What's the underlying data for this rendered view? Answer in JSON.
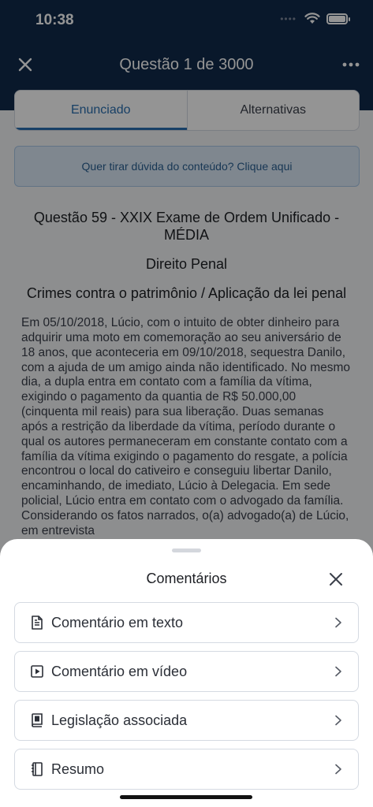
{
  "status_bar": {
    "time": "10:38",
    "signal_dots": "••••"
  },
  "header": {
    "title": "Questão 1 de 3000",
    "close_icon": "close-icon",
    "more_icon": "more-icon"
  },
  "tabs": [
    {
      "label": "Enunciado",
      "active": true
    },
    {
      "label": "Alternativas",
      "active": false
    }
  ],
  "doubt_banner": {
    "text": "Quer tirar dúvida do conteúdo? Clique aqui"
  },
  "question": {
    "title": "Questão 59 - XXIX Exame de Ordem Unificado - MÉDIA",
    "subject": "Direito Penal",
    "topic": "Crimes contra o patrimônio / Aplicação da lei penal",
    "body": "Em 05/10/2018, Lúcio, com o intuito de obter dinheiro para adquirir uma moto em comemoração ao seu aniversário de 18 anos, que aconteceria em 09/10/2018, sequestra Danilo, com a ajuda de um amigo ainda não identificado. No mesmo dia, a dupla entra em contato com a família da vítima, exigindo o pagamento da quantia de R$ 50.000,00 (cinquenta mil reais) para sua liberação. Duas semanas após a restrição da liberdade da vítima, período durante o qual os autores permaneceram em constante contato com a família da vítima exigindo o pagamento do resgate, a polícia encontrou o local do cativeiro e conseguiu libertar Danilo, encaminhando, de imediato, Lúcio à Delegacia. Em sede policial, Lúcio entra em contato com o advogado da família. Considerando os fatos narrados, o(a) advogado(a) de Lúcio, em entrevista"
  },
  "sheet": {
    "title": "Comentários",
    "options": [
      {
        "label": "Comentário em texto",
        "icon": "document-icon"
      },
      {
        "label": "Comentário em vídeo",
        "icon": "video-icon"
      },
      {
        "label": "Legislação associada",
        "icon": "book-icon"
      },
      {
        "label": "Resumo",
        "icon": "notebook-icon"
      }
    ]
  },
  "colors": {
    "header_bg": "#102a4a",
    "accent": "#2a6fb0",
    "banner_bg": "#dbe9f7",
    "overlay": "rgba(0,0,0,0.42)"
  }
}
